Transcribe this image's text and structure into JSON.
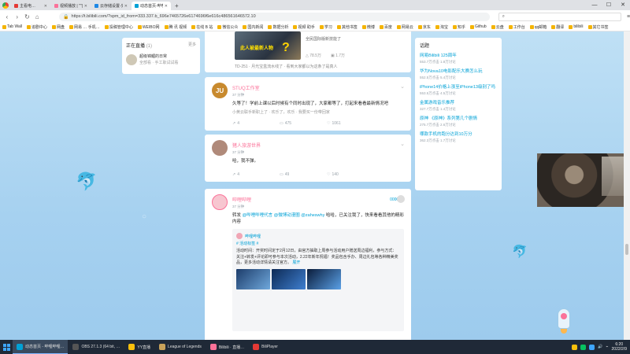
{
  "browser": {
    "tabs": [
      {
        "label": "主看电…",
        "active": false,
        "color": "#e53935"
      },
      {
        "label": "视频播放 | \"\"(小) 手机…",
        "active": false,
        "color": "#fb7299"
      },
      {
        "label": "云存储设置-实时打印_自动…",
        "active": false,
        "color": "#1e88e5"
      },
      {
        "label": "动态首页-哔哩哔哩",
        "active": true,
        "color": "#00a1d6"
      }
    ],
    "new_tab": "+",
    "url": "https://t.bilibili.com/?spm_id_from=333.337.b_696e7465726e6174696f6e616c486561646572.10",
    "search_placeholder": "",
    "window_controls": [
      "—",
      "☐",
      "✕"
    ]
  },
  "bookmarks": [
    "Tab Wall",
    "追剧中心",
    "网盘",
    "网易 … 手机…",
    "投稿管理中心",
    "WEIBO网",
    "腾 讯 视频",
    "在线 B 站",
    "微信公众",
    "国内新闻",
    "数据分析",
    "视频 助手",
    "学习",
    "其他书签",
    "微博",
    "百度",
    "网易云",
    "京东",
    "淘宝",
    "知乎",
    "Github",
    "云盘",
    "工作台",
    "qq邮箱",
    "翻译",
    "bilibili",
    "其它书签"
  ],
  "live": {
    "title": "正在直播",
    "count": "(1)",
    "more": "更多",
    "item_name": "超级锦鲤的日常",
    "item_sub": "全部看 · 手工耿试试看"
  },
  "feed": {
    "top": {
      "thumb_text": "此人被最新人物",
      "thumb_q": "?",
      "desc": "全民国际版新技能了",
      "stats": [
        "△ 78.5万",
        "▣ 1.7万"
      ],
      "footer": "TD-251 · 月光宝盒流水线了 · 看到大家都以为这条了是真人"
    },
    "cards": [
      {
        "name": "STUQ工作室",
        "time": "37 分钟",
        "text": "久等了！学前上课以后时候有个同时出现了，大家都等了，打起来看看最新情况吧",
        "sub": "小黄云联手新职上了 · 欢乐了，欢乐 · 我要买一份带回家",
        "actions": [
          "4",
          "475",
          "1061"
        ],
        "avatar_text": "JU",
        "avatar_color": "#c88a2e"
      },
      {
        "name": "猪人旅游世界",
        "time": "37 分钟",
        "text": "哈，我不弹。",
        "actions": [
          "4",
          "49",
          "140"
        ],
        "avatar_text": "",
        "avatar_color": "#b08a7a"
      },
      {
        "name": "哔哩哔哩",
        "time": "37 分钟",
        "badge": "00000",
        "text_pre": "转发",
        "mention1": "@哔哩哔哩代言",
        "mention2": "@微博动漫圈",
        "mention3": "@zaheswhy",
        "text_post": "哈哈，已关注我了，快来看看其他的精彩内容",
        "repost_name": "哔哩哔哩",
        "repost_tag": "# 活动标签 #",
        "repost_text": "活动时间：开奖时间定于2月12日，由官方抽取上周参与活动用户赠送周边福利，参与方式：关注+转发+评论即可参与本次活动，2.22年新年祝福！奖品包含手办、周边礼包等各种精美奖品，更多活动详情请关注官方。",
        "repost_expand": "展开",
        "avatar_color": "#f7c6d0"
      }
    ]
  },
  "hot": {
    "title": "话题",
    "items": [
      {
        "label": "网易Bilibili 125周年",
        "sub": "553.7万点击 1.8万讨论"
      },
      {
        "label": "华为Nova10电影配乐大赛怎么玩",
        "sub": "552.5万点击 5.4万讨论"
      },
      {
        "label": "iPhone14价格上涨至iPhone13级别了吗",
        "sub": "553.5万点击 4.5万讨论"
      },
      {
        "label": "金属游戏音乐推荐",
        "sub": "327.7万点击 1.4万讨论"
      },
      {
        "label": "原神 《原神》系列第几个剧情",
        "sub": "275.7万点击 2.6万讨论"
      },
      {
        "label": "哪款手机的跑分达到10万分",
        "sub": "362.3万点击 1.7万讨论"
      }
    ]
  },
  "taskbar": {
    "items": [
      {
        "label": "动态首页 - 哔哩哔哩…",
        "color": "#00a1d6",
        "active": true
      },
      {
        "label": "OBS 27.1.3 (64 bit, …",
        "color": "#555",
        "active": false
      },
      {
        "label": "YY直播",
        "color": "#f9c00c",
        "active": false
      },
      {
        "label": "League of Legends",
        "color": "#c8a25a",
        "active": false
      },
      {
        "label": "Bilibili · 直播…",
        "color": "#fb7299",
        "active": false
      },
      {
        "label": "BiliPlayer",
        "color": "#e53935",
        "active": false
      }
    ],
    "time": "6:20",
    "date": "2022/2/9"
  }
}
